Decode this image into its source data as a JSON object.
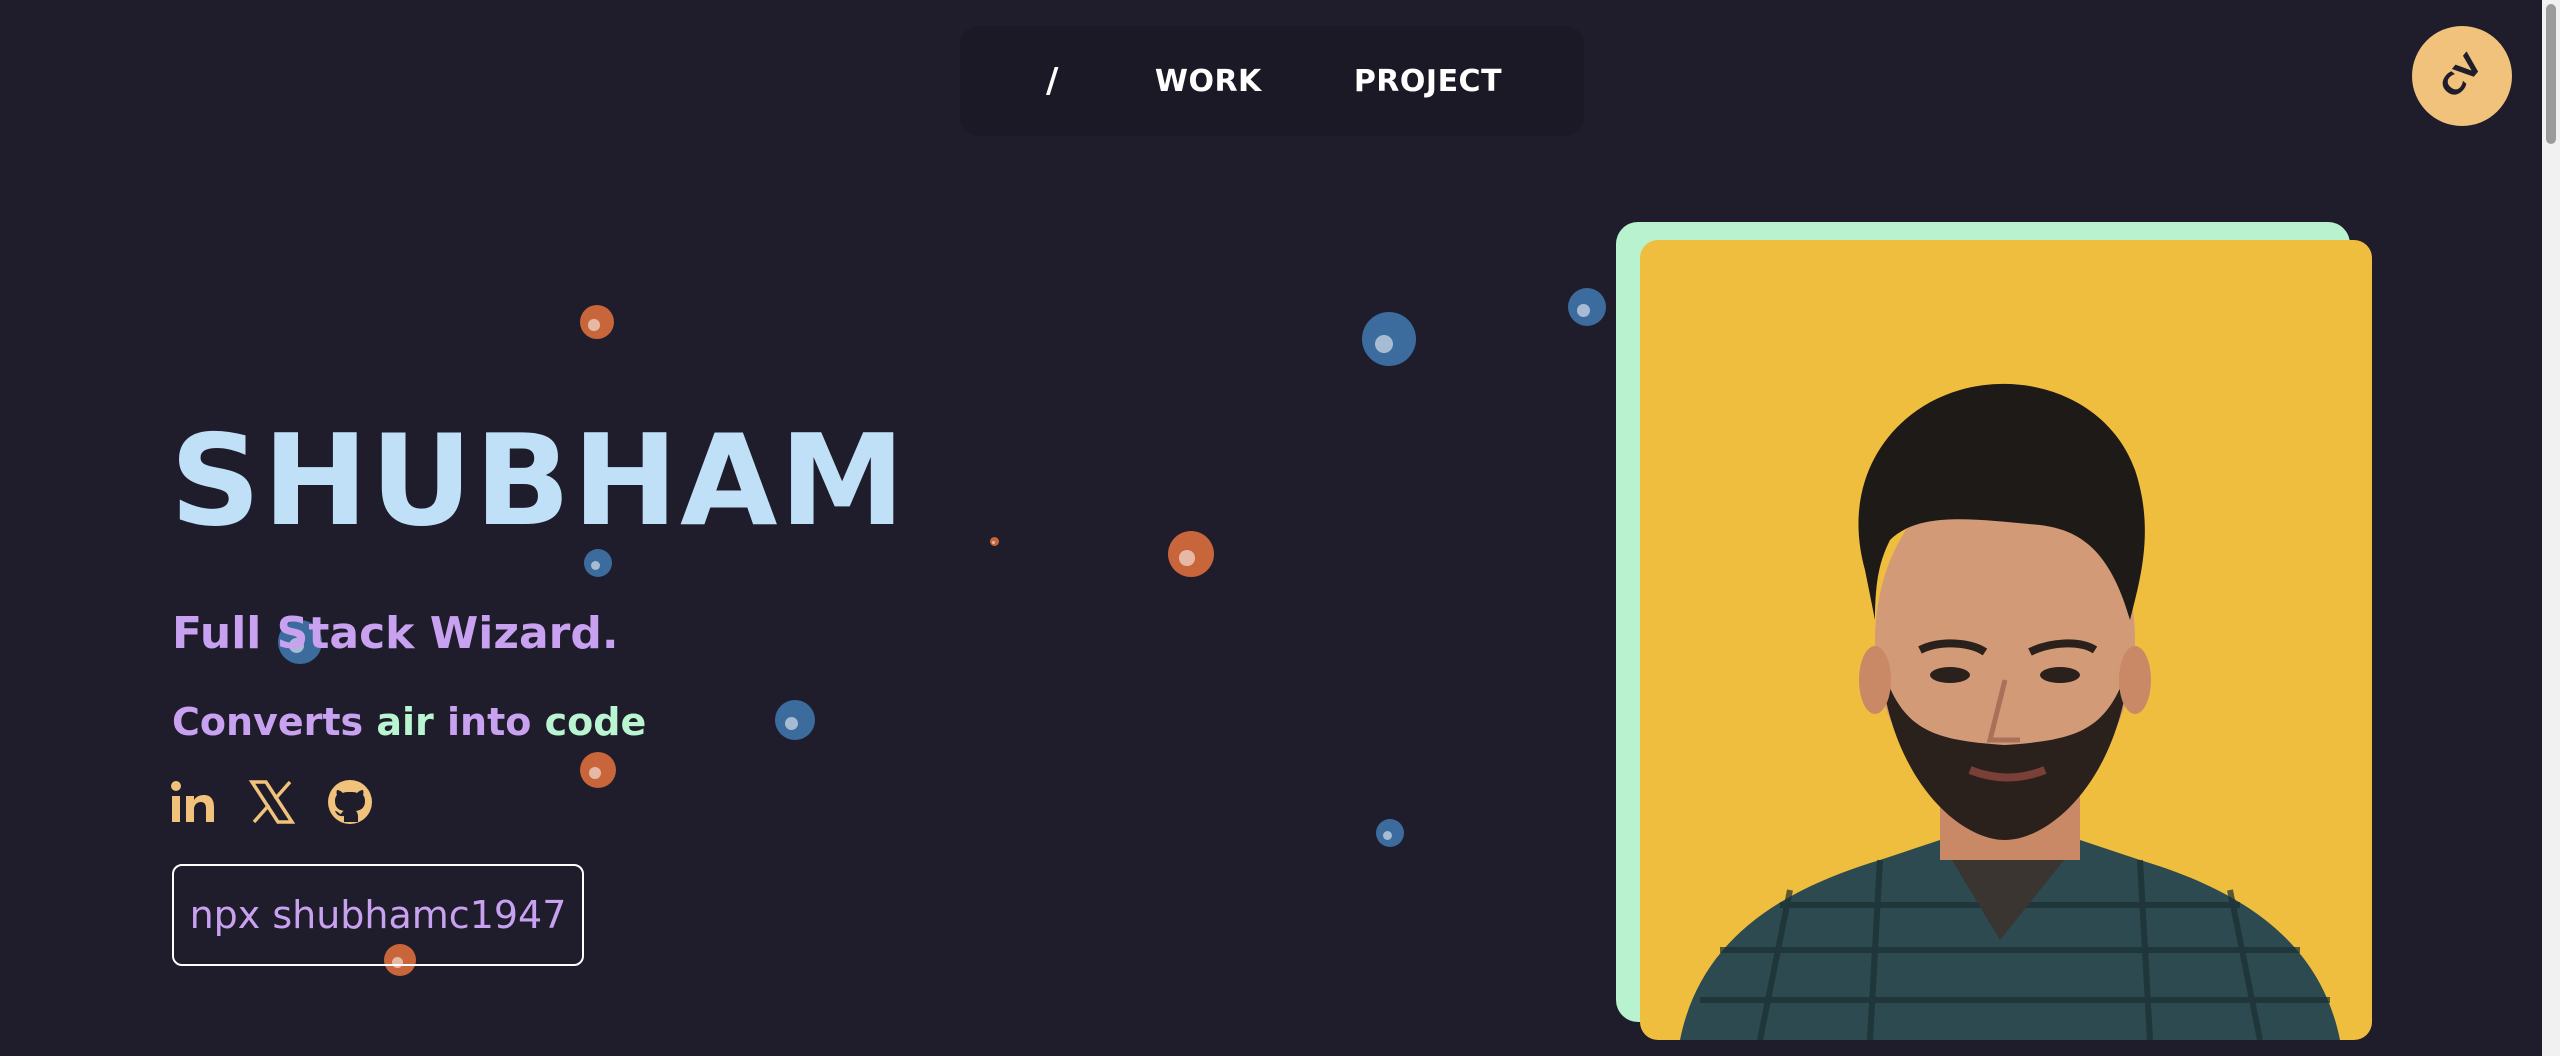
{
  "nav": {
    "items": [
      {
        "label": "/"
      },
      {
        "label": "WORK"
      },
      {
        "label": "PROJECT"
      }
    ]
  },
  "cv_button": {
    "label": "CV"
  },
  "hero": {
    "name": "SHUBHAM",
    "tagline": "Full Stack Wizard.",
    "converts": {
      "w1": "Converts",
      "w2": "air",
      "w3": "into",
      "w4": "code"
    },
    "socials": [
      {
        "icon": "linkedin-icon"
      },
      {
        "icon": "x-twitter-icon"
      },
      {
        "icon": "github-icon"
      }
    ],
    "npx_command": "npx shubhamc1947"
  },
  "colors": {
    "background": "#1f1d2b",
    "name": "#bfe0f7",
    "tagline": "#c8a2f0",
    "accent_green": "#b9f5d0",
    "icon": "#f0c27b",
    "photo_bg": "#f0be3e",
    "photo_frame": "#b9f2cf"
  }
}
